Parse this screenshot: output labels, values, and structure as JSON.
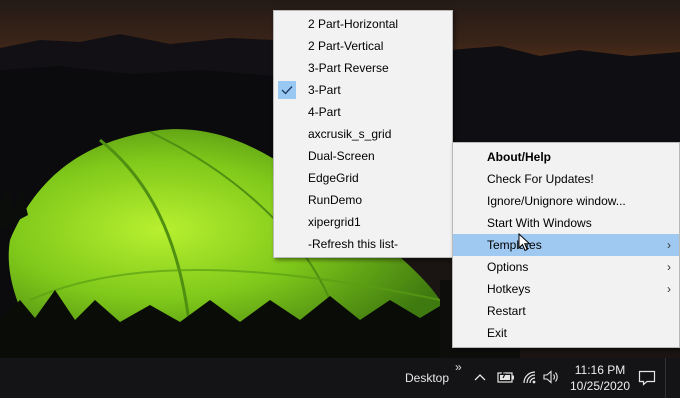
{
  "templates_menu": {
    "items": [
      {
        "label": "2 Part-Horizontal",
        "checked": false
      },
      {
        "label": "2 Part-Vertical",
        "checked": false
      },
      {
        "label": "3-Part Reverse",
        "checked": false
      },
      {
        "label": "3-Part",
        "checked": true
      },
      {
        "label": "4-Part",
        "checked": false
      },
      {
        "label": "axcrusik_s_grid",
        "checked": false
      },
      {
        "label": "Dual-Screen",
        "checked": false
      },
      {
        "label": "EdgeGrid",
        "checked": false
      },
      {
        "label": "RunDemo",
        "checked": false
      },
      {
        "label": "xipergrid1",
        "checked": false
      },
      {
        "label": "-Refresh this list-",
        "checked": false
      }
    ]
  },
  "context_menu": {
    "about": "About/Help",
    "check_updates": "Check For Updates!",
    "ignore_window": "Ignore/Unignore window...",
    "start_with_windows": "Start With Windows",
    "templates": "Templates",
    "options": "Options",
    "hotkeys": "Hotkeys",
    "restart": "Restart",
    "exit": "Exit"
  },
  "taskbar": {
    "desktop_label": "Desktop",
    "expand_glyph": "»",
    "time": "11:16 PM",
    "date": "10/25/2020"
  },
  "colors": {
    "highlight": "#9fc9f0",
    "check_bg": "#99c8f2",
    "menu_bg": "#f2f2f2",
    "taskbar_bg": "#141416"
  },
  "icons": [
    "check-icon",
    "chevron-right-icon",
    "chevron-up-icon",
    "battery-icon",
    "wifi-icon",
    "volume-icon",
    "notification-icon",
    "mouse-cursor"
  ]
}
